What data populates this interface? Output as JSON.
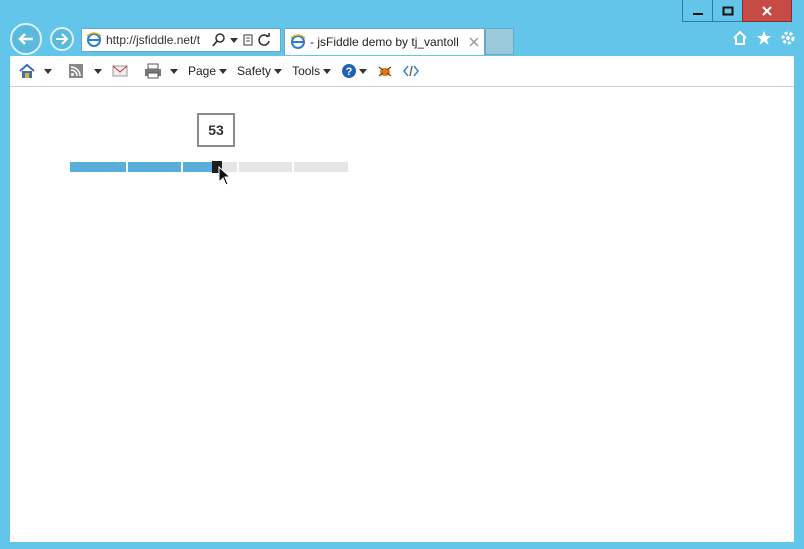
{
  "browser": {
    "address": "http://jsfiddle.net/t",
    "tab_title": "- jsFiddle demo by tj_vantoll",
    "window_controls": [
      "minimize",
      "restore",
      "close"
    ]
  },
  "commandbar": {
    "page_label": "Page",
    "safety_label": "Safety",
    "tools_label": "Tools"
  },
  "slider": {
    "value_text": "53",
    "value": 53,
    "min": 0,
    "max": 100
  }
}
